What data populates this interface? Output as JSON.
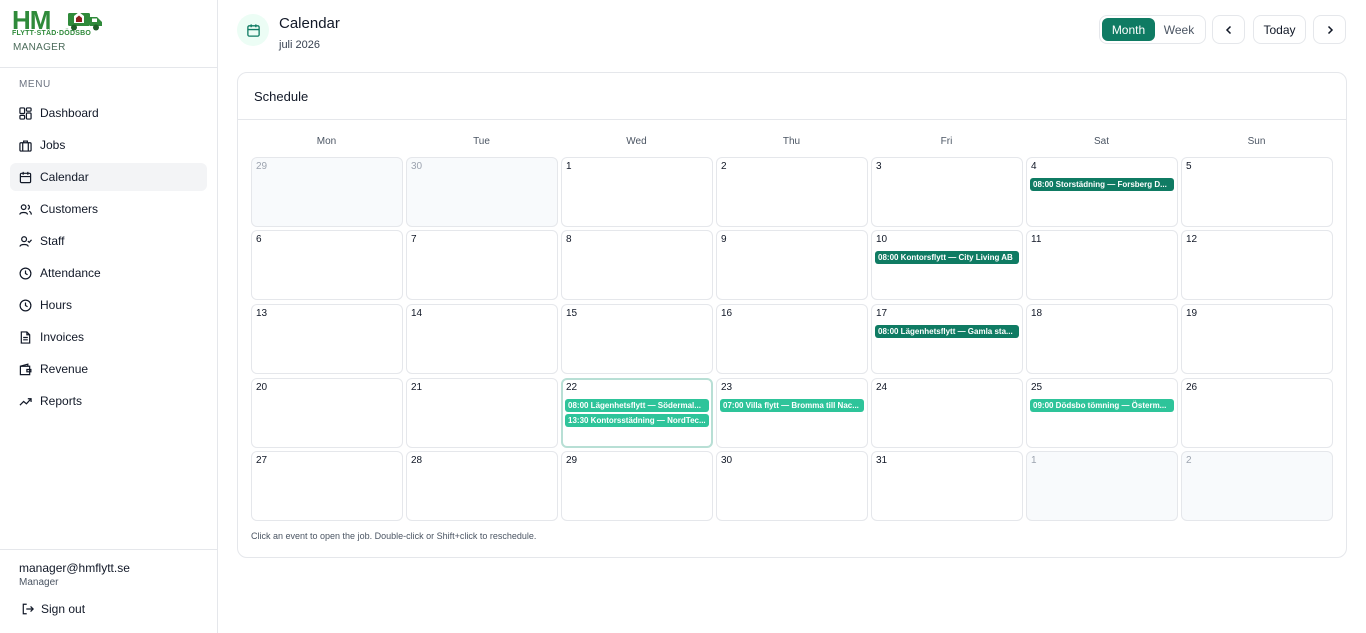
{
  "brand": {
    "letters": "HM",
    "tagline": "FLYTT·STÄD·DÖDSBO",
    "subtitle": "MANAGER",
    "green": "#2f8a3a"
  },
  "sidebar": {
    "menu_heading": "MENU",
    "items": [
      {
        "label": "Dashboard",
        "icon": "dashboard-icon",
        "active": false
      },
      {
        "label": "Jobs",
        "icon": "briefcase-icon",
        "active": false
      },
      {
        "label": "Calendar",
        "icon": "calendar-icon",
        "active": true
      },
      {
        "label": "Customers",
        "icon": "users-icon",
        "active": false
      },
      {
        "label": "Staff",
        "icon": "user-check-icon",
        "active": false
      },
      {
        "label": "Attendance",
        "icon": "clock-icon",
        "active": false
      },
      {
        "label": "Hours",
        "icon": "clock-icon",
        "active": false
      },
      {
        "label": "Invoices",
        "icon": "file-text-icon",
        "active": false
      },
      {
        "label": "Revenue",
        "icon": "wallet-icon",
        "active": false
      },
      {
        "label": "Reports",
        "icon": "trending-up-icon",
        "active": false
      }
    ],
    "user": {
      "email": "manager@hmflytt.se",
      "role": "Manager"
    },
    "signout_label": "Sign out"
  },
  "header": {
    "title": "Calendar",
    "subtitle": "juli 2026",
    "view_toggle": {
      "month_label": "Month",
      "week_label": "Week",
      "selected": "Month"
    },
    "today_label": "Today"
  },
  "schedule": {
    "title": "Schedule",
    "weekdays": [
      "Mon",
      "Tue",
      "Wed",
      "Thu",
      "Fri",
      "Sat",
      "Sun"
    ],
    "hint": "Click an event to open the job. Double-click or Shift+click to reschedule.",
    "colors": {
      "accent": "#0f7b63",
      "event_dark": "#0f7b63",
      "event_light": "#2ec49a",
      "today_border": "#b8dfd5"
    },
    "weeks": [
      [
        {
          "day": "29",
          "outside": true,
          "events": []
        },
        {
          "day": "30",
          "outside": true,
          "events": []
        },
        {
          "day": "1",
          "events": []
        },
        {
          "day": "2",
          "events": []
        },
        {
          "day": "3",
          "events": []
        },
        {
          "day": "4",
          "events": [
            {
              "text": "08:00 Storstädning — Forsberg D...",
              "style": "dark"
            }
          ]
        },
        {
          "day": "5",
          "events": []
        }
      ],
      [
        {
          "day": "6",
          "events": []
        },
        {
          "day": "7",
          "events": []
        },
        {
          "day": "8",
          "events": []
        },
        {
          "day": "9",
          "events": []
        },
        {
          "day": "10",
          "events": [
            {
              "text": "08:00 Kontorsflytt — City Living AB",
              "style": "dark"
            }
          ]
        },
        {
          "day": "11",
          "events": []
        },
        {
          "day": "12",
          "events": []
        }
      ],
      [
        {
          "day": "13",
          "events": []
        },
        {
          "day": "14",
          "events": []
        },
        {
          "day": "15",
          "events": []
        },
        {
          "day": "16",
          "events": []
        },
        {
          "day": "17",
          "events": [
            {
              "text": "08:00 Lägenhetsflytt — Gamla sta...",
              "style": "dark"
            }
          ]
        },
        {
          "day": "18",
          "events": []
        },
        {
          "day": "19",
          "events": []
        }
      ],
      [
        {
          "day": "20",
          "events": []
        },
        {
          "day": "21",
          "events": []
        },
        {
          "day": "22",
          "today": true,
          "events": [
            {
              "text": "08:00 Lägenhetsflytt — Södermal...",
              "style": "light"
            },
            {
              "text": "13:30 Kontorsstädning — NordTec...",
              "style": "light"
            }
          ]
        },
        {
          "day": "23",
          "events": [
            {
              "text": "07:00 Villa flytt — Bromma till Nac...",
              "style": "light"
            }
          ]
        },
        {
          "day": "24",
          "events": []
        },
        {
          "day": "25",
          "events": [
            {
              "text": "09:00 Dödsbo tömning — Österm...",
              "style": "light"
            }
          ]
        },
        {
          "day": "26",
          "events": []
        }
      ],
      [
        {
          "day": "27",
          "events": []
        },
        {
          "day": "28",
          "events": []
        },
        {
          "day": "29",
          "events": []
        },
        {
          "day": "30",
          "events": []
        },
        {
          "day": "31",
          "events": []
        },
        {
          "day": "1",
          "outside": true,
          "events": []
        },
        {
          "day": "2",
          "outside": true,
          "events": []
        }
      ]
    ]
  }
}
